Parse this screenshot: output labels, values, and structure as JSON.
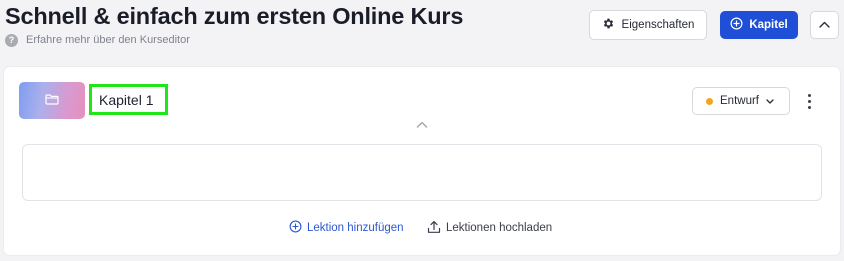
{
  "header": {
    "title": "Schnell & einfach zum ersten Online Kurs",
    "help_text": "Erfahre mehr über den Kurseditor",
    "properties_button": "Eigenschaften",
    "add_chapter_button": "Kapitel",
    "accent_color": "#1f4fd6"
  },
  "chapter": {
    "title": "Kapitel 1",
    "thumbnail_icon": "folder-icon",
    "status": {
      "selected": "Entwurf",
      "dot_color": "#f0a623"
    },
    "actions": {
      "add_lesson": "Lektion hinzufügen",
      "upload_lessons": "Lektionen hochladen"
    }
  }
}
